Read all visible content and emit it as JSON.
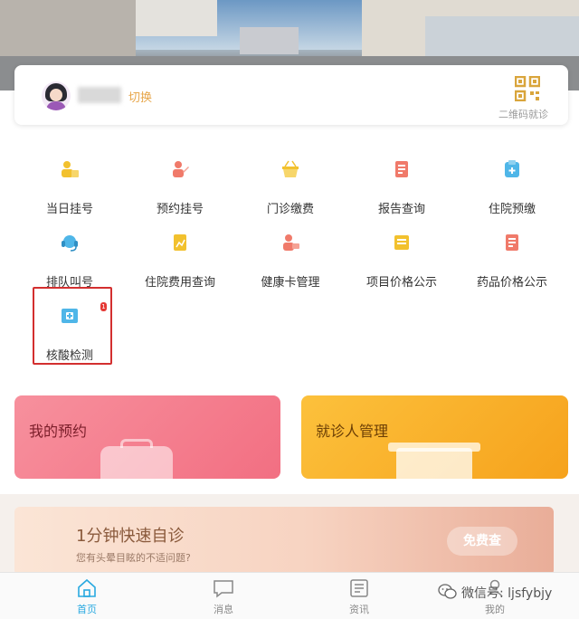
{
  "user": {
    "name": "██",
    "switch_label": "切换",
    "qr_label": "二维码就诊"
  },
  "menu": [
    {
      "label": "当日挂号",
      "icon": "register-today-icon",
      "color": "#f2c12e"
    },
    {
      "label": "预约挂号",
      "icon": "appointment-icon",
      "color": "#f07a6a"
    },
    {
      "label": "门诊缴费",
      "icon": "payment-basket-icon",
      "color": "#f2c12e"
    },
    {
      "label": "报告查询",
      "icon": "report-icon",
      "color": "#f07a6a"
    },
    {
      "label": "住院预缴",
      "icon": "hospital-deposit-icon",
      "color": "#4fb6e8"
    },
    {
      "label": "排队叫号",
      "icon": "queue-headset-icon",
      "color": "#4fb6e8"
    },
    {
      "label": "住院费用查询",
      "icon": "hospital-fee-icon",
      "color": "#f2c12e"
    },
    {
      "label": "健康卡管理",
      "icon": "health-card-icon",
      "color": "#f07a6a"
    },
    {
      "label": "项目价格公示",
      "icon": "item-price-icon",
      "color": "#f2c12e"
    },
    {
      "label": "药品价格公示",
      "icon": "drug-price-icon",
      "color": "#f07a6a"
    },
    {
      "label": "核酸检测",
      "icon": "nucleic-test-icon",
      "color": "#4fb6e8"
    }
  ],
  "badge": "1",
  "cards": {
    "appointments": "我的预约",
    "patients": "就诊人管理"
  },
  "banner": {
    "title": "1分钟快速自诊",
    "subtitle": "您有头晕目眩的不适问题?",
    "button": "免费查"
  },
  "nav": [
    {
      "label": "首页",
      "icon": "home-icon",
      "active": true
    },
    {
      "label": "消息",
      "icon": "message-icon",
      "active": false
    },
    {
      "label": "资讯",
      "icon": "news-icon",
      "active": false
    },
    {
      "label": "我的",
      "icon": "profile-icon",
      "active": false
    }
  ],
  "watermark": "微信号: ljsfybjy",
  "colors": {
    "accent_blue": "#29a9e0",
    "switch_orange": "#e7a64a",
    "highlight_red": "#d32f2f"
  }
}
